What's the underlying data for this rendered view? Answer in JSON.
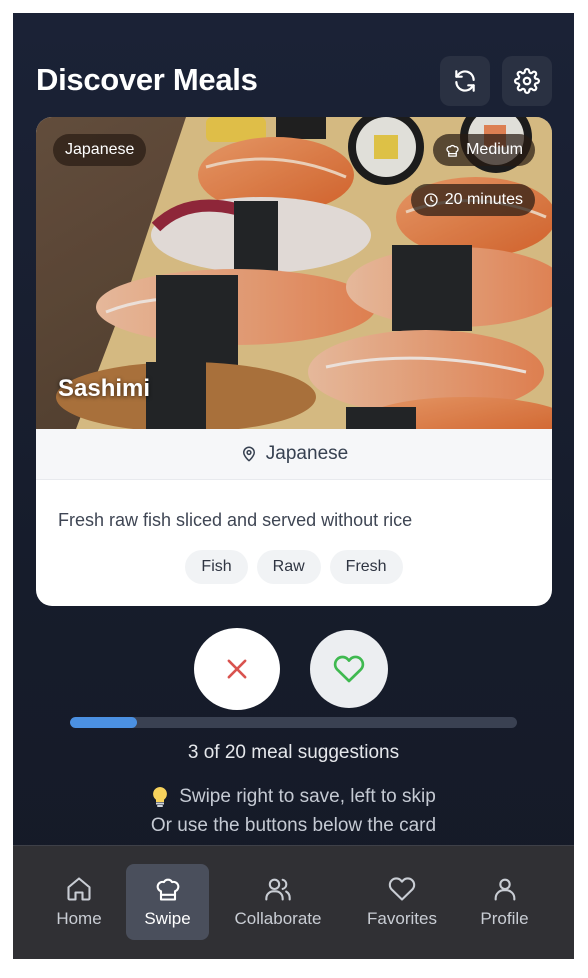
{
  "header": {
    "title": "Discover Meals",
    "refresh_icon": "refresh-icon",
    "settings_icon": "gear-icon"
  },
  "card": {
    "cuisine_badge": "Japanese",
    "difficulty_badge": "Medium",
    "time_badge": "20 minutes",
    "meal_name": "Sashimi",
    "origin": "Japanese",
    "description": "Fresh raw fish sliced and served without rice",
    "tags": [
      "Fish",
      "Raw",
      "Fresh"
    ]
  },
  "actions": {
    "skip_icon": "x-icon",
    "save_icon": "heart-icon",
    "skip_color": "#d9534f",
    "save_color": "#3fb950"
  },
  "progress": {
    "current": 3,
    "total": 20,
    "fraction": 0.15,
    "label": "3 of 20 meal suggestions"
  },
  "hints": {
    "line1": "Swipe right to save, left to skip",
    "line2": "Or use the buttons below the card"
  },
  "nav": {
    "items": [
      {
        "label": "Home",
        "icon": "home-icon"
      },
      {
        "label": "Swipe",
        "icon": "chef-hat-icon",
        "active": true
      },
      {
        "label": "Collaborate",
        "icon": "users-icon"
      },
      {
        "label": "Favorites",
        "icon": "heart-icon"
      },
      {
        "label": "Profile",
        "icon": "user-icon"
      }
    ]
  },
  "colors": {
    "background": "#161c2b",
    "accent": "#4b90e2",
    "nav_background": "#303034"
  }
}
